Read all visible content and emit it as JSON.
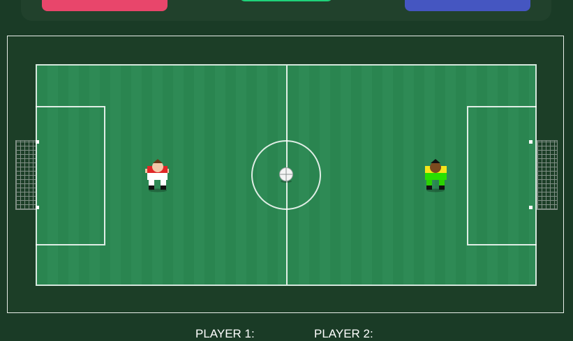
{
  "scoreboard": {
    "player1_label": "PLAYER 1:",
    "player2_label": "PLAYER 2:"
  },
  "colors": {
    "player1_button": "#e8466b",
    "center_button": "#1fd27a",
    "player2_button": "#4556c1",
    "pitch": "#2b8751",
    "player1_shirt": "red-white",
    "player2_shirt": "yellow-green"
  },
  "icons": {
    "ball": "soccer-ball-icon",
    "player1": "player-red-icon",
    "player2": "player-yellow-icon"
  }
}
